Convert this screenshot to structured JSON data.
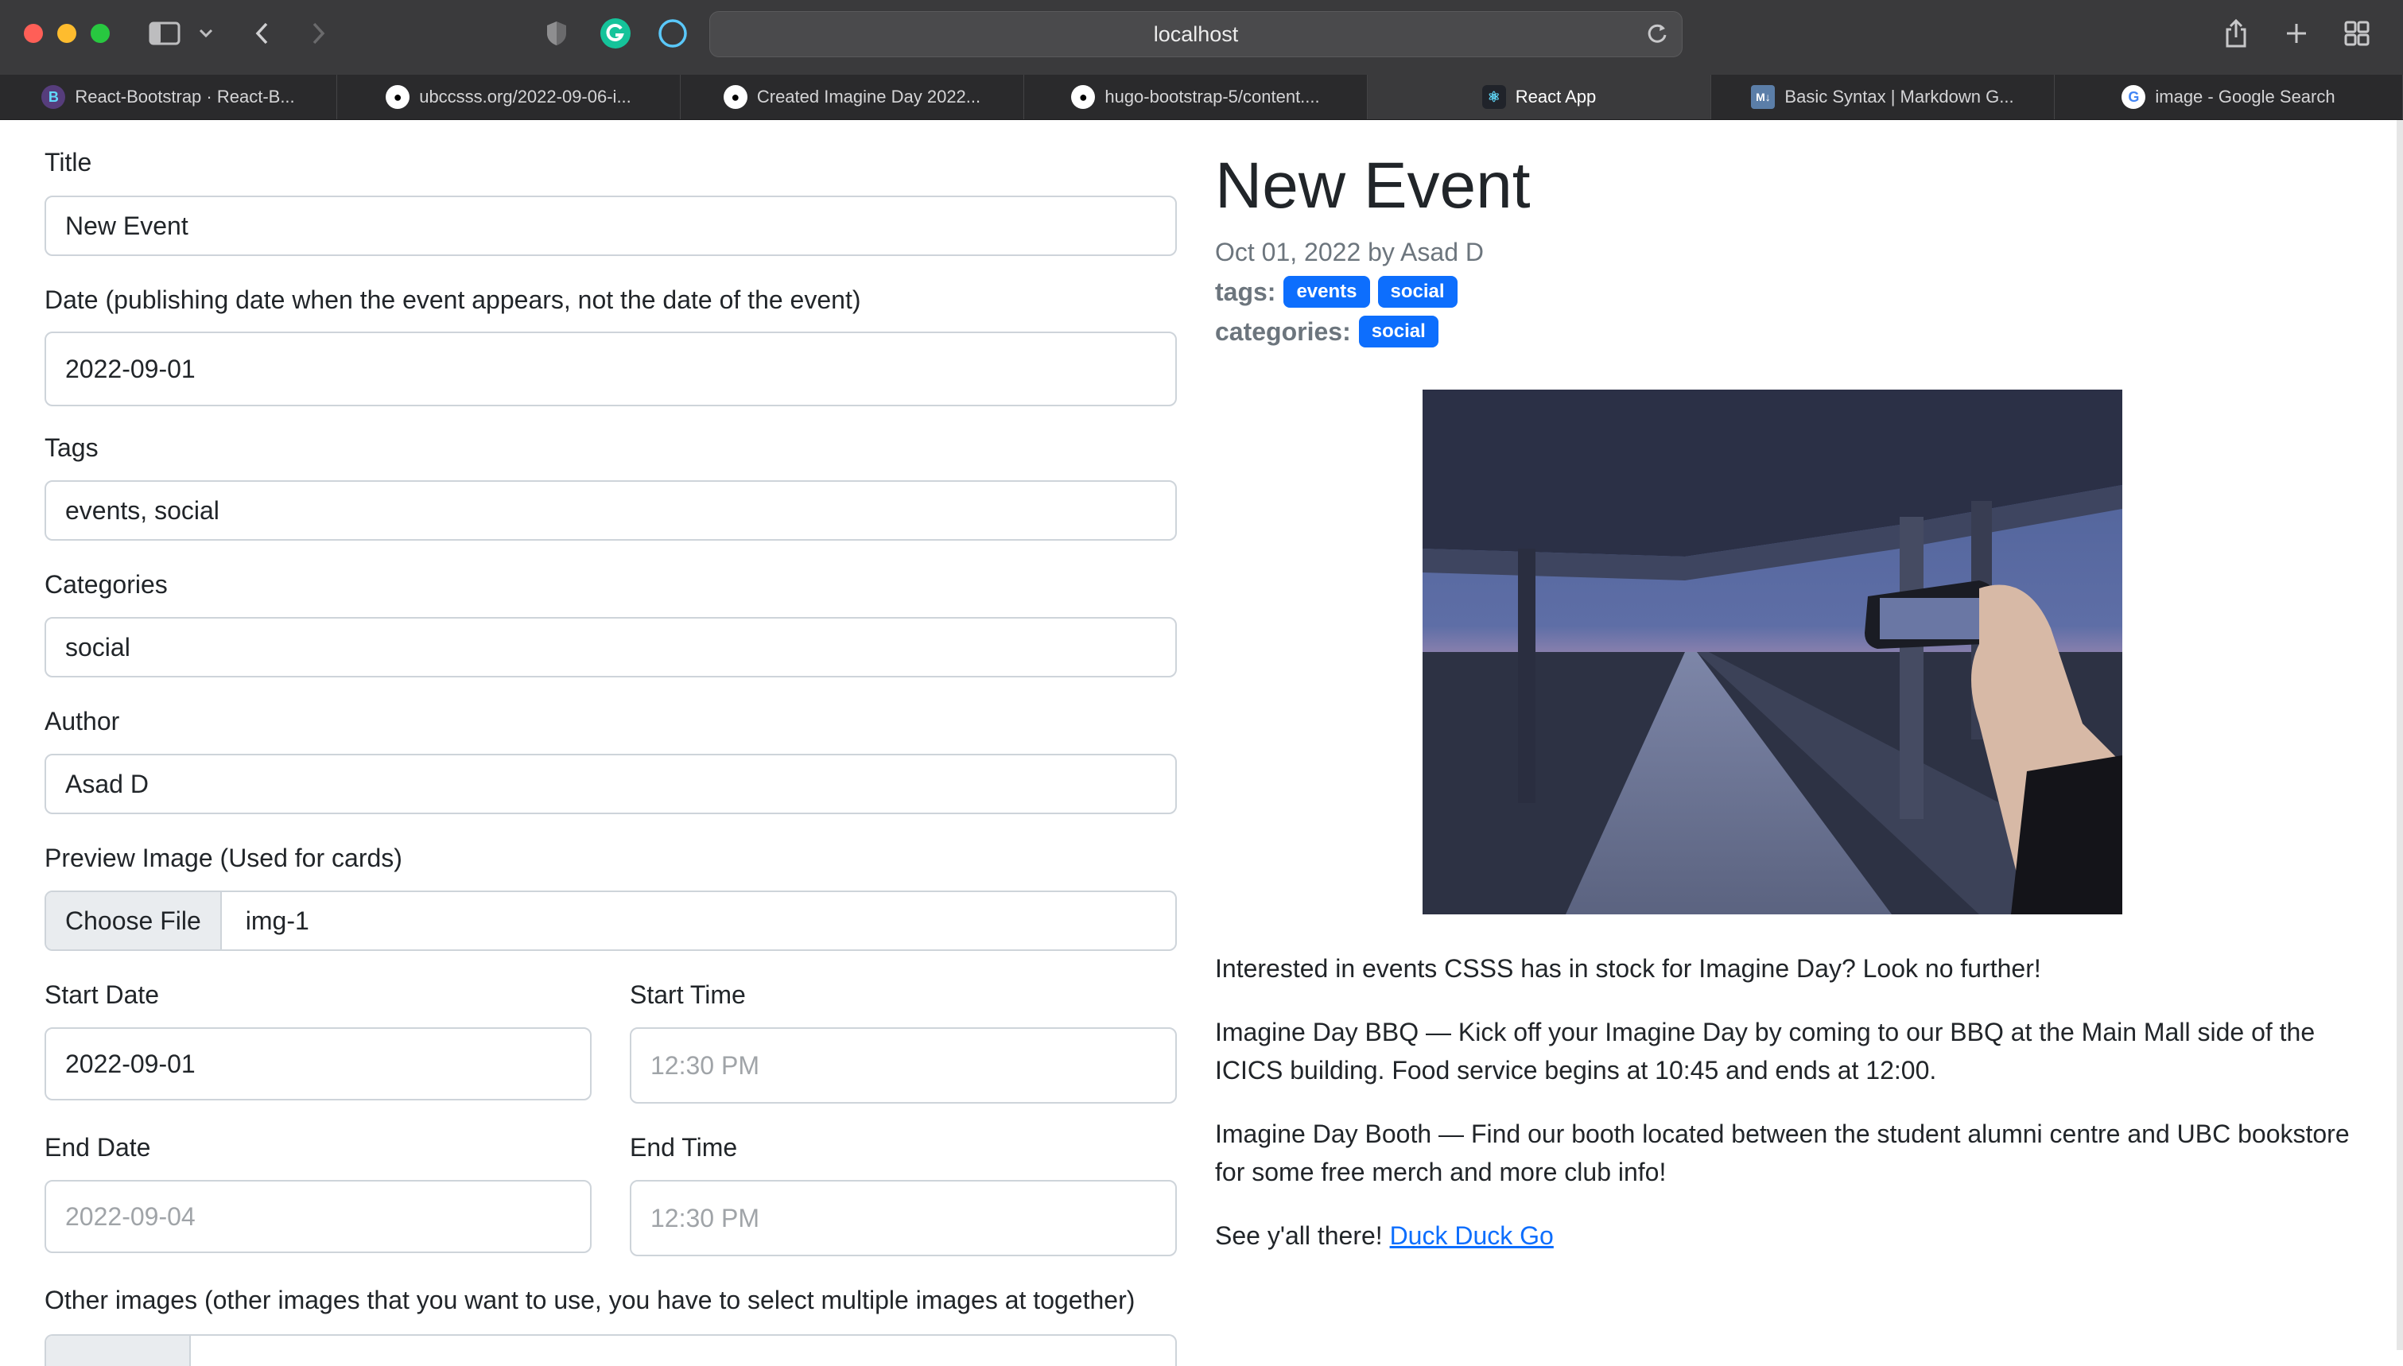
{
  "browser": {
    "url": "localhost",
    "tabs": [
      {
        "label": "React-Bootstrap · React-B...",
        "icon": "react-bootstrap-icon"
      },
      {
        "label": "ubccsss.org/2022-09-06-i...",
        "icon": "github-icon"
      },
      {
        "label": "Created Imagine Day 2022...",
        "icon": "github-icon"
      },
      {
        "label": "hugo-bootstrap-5/content....",
        "icon": "github-icon"
      },
      {
        "label": "React App",
        "icon": "react-icon",
        "active": true
      },
      {
        "label": "Basic Syntax | Markdown G...",
        "icon": "markdown-icon"
      },
      {
        "label": "image - Google Search",
        "icon": "google-icon"
      }
    ]
  },
  "form": {
    "title_label": "Title",
    "title_value": "New Event",
    "date_label": "Date (publishing date when the event appears, not the date of the event)",
    "date_value": "2022-09-01",
    "tags_label": "Tags",
    "tags_value": "events, social",
    "categories_label": "Categories",
    "categories_value": "social",
    "author_label": "Author",
    "author_value": "Asad D",
    "preview_image_label": "Preview Image (Used for cards)",
    "choose_file_label": "Choose File",
    "file_name": "img-1",
    "start_date_label": "Start Date",
    "start_date_value": "2022-09-01",
    "start_time_label": "Start Time",
    "start_time_value": "12:30 PM",
    "end_date_label": "End Date",
    "end_date_value": "2022-09-04",
    "end_time_label": "End Time",
    "end_time_value": "12:30 PM",
    "other_images_label": "Other images (other images that you want to use, you have to select multiple images at together)"
  },
  "preview": {
    "title": "New Event",
    "meta": "Oct 01, 2022 by Asad D",
    "tags_label": "tags:",
    "tags": [
      "events",
      "social"
    ],
    "categories_label": "categories:",
    "categories": [
      "social"
    ],
    "p1": "Interested in events CSSS has in stock for Imagine Day? Look no further!",
    "p2": "Imagine Day BBQ — Kick off your Imagine Day by coming to our BBQ at the Main Mall side of the ICICS building. Food service begins at 10:45 and ends at 12:00.",
    "p3": "Imagine Day Booth — Find our booth located between the student alumni centre and UBC bookstore for some free merch and more club info!",
    "p4_text": "See y'all there! ",
    "p4_link": "Duck Duck Go"
  },
  "colors": {
    "accent": "#0d6efd",
    "chrome": "#3a3a3c",
    "tabbar": "#2a2a2c"
  }
}
